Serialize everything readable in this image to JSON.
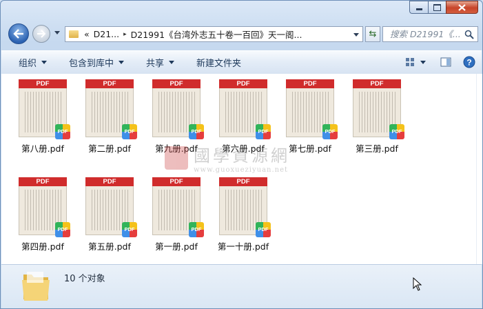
{
  "titlebar": {
    "min_icon": "minimize-icon",
    "max_icon": "maximize-icon",
    "close_icon": "close-icon"
  },
  "nav": {
    "address_segments": [
      "«",
      "D21...",
      "▸",
      "D21991《台湾外志五十卷一百回》天一阁..."
    ],
    "search_placeholder": "搜索 D21991《...",
    "icons": [
      "back-arrow-icon",
      "forward-arrow-icon",
      "refresh-icon",
      "search-icon"
    ]
  },
  "toolbar": {
    "organize": "组织",
    "include_library": "包含到库中",
    "share": "共享",
    "new_folder": "新建文件夹"
  },
  "files": [
    {
      "name": "第八册.pdf"
    },
    {
      "name": "第二册.pdf"
    },
    {
      "name": "第九册.pdf"
    },
    {
      "name": "第六册.pdf"
    },
    {
      "name": "第七册.pdf"
    },
    {
      "name": "第三册.pdf"
    },
    {
      "name": "第四册.pdf"
    },
    {
      "name": "第五册.pdf"
    },
    {
      "name": "第一册.pdf"
    },
    {
      "name": "第一十册.pdf"
    }
  ],
  "thumb_band": "PDF",
  "thumb_badge": "PDF",
  "watermark": {
    "cn": "國學資源網",
    "url": "www.guoxueziyuan.net"
  },
  "status": {
    "count_text": "10 个对象"
  },
  "colors": {
    "pdf_red": "#d02c2c",
    "accent_blue": "#2b62b2"
  }
}
